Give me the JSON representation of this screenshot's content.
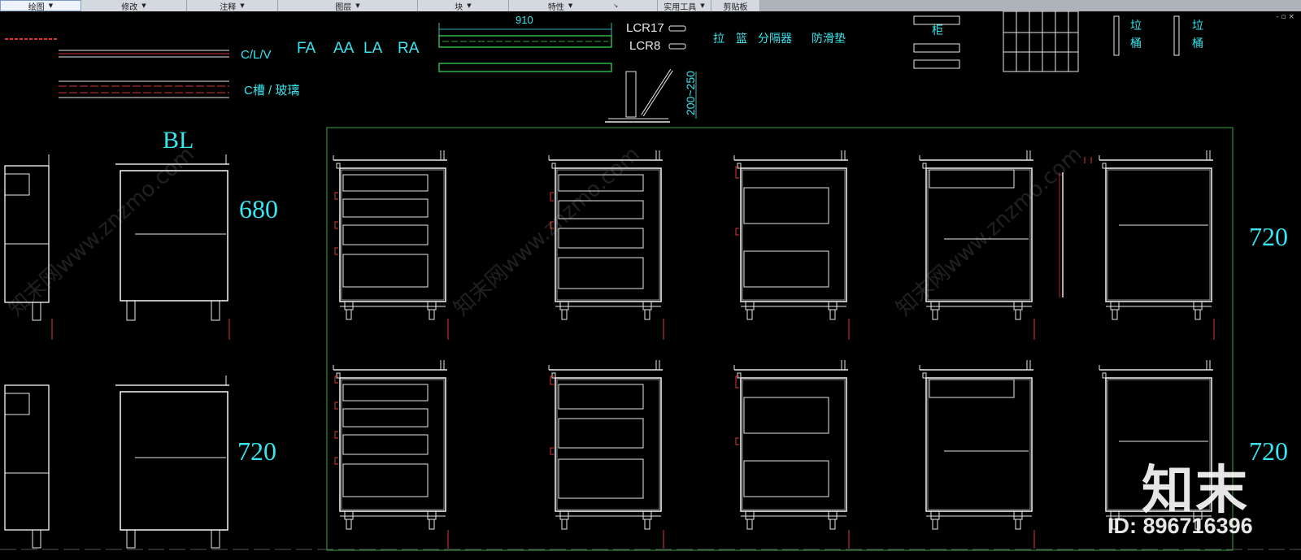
{
  "ribbon": {
    "panels": [
      {
        "label": "绘图"
      },
      {
        "label": "修改"
      },
      {
        "label": "注释"
      },
      {
        "label": "图层"
      },
      {
        "label": "块"
      },
      {
        "label": "特性"
      },
      {
        "label": "实用工具"
      },
      {
        "label": "剪贴板"
      }
    ]
  },
  "window_controls": "- ▫ ×",
  "drawing": {
    "labels": {
      "clv": "C/L/V",
      "c_groove": "C槽 / 玻璃",
      "fa": "FA",
      "aa": "AA",
      "la": "LA",
      "ra": "RA",
      "dim_910": "910",
      "lcr17": "LCR17",
      "lcr8": "LCR8",
      "lalan": "拉　篮",
      "divider": "分隔器",
      "antislip": "防滑垫",
      "gui": "柜",
      "laji1": "垃\n桶",
      "laji2": "垃\n桶",
      "dim_200_250": "200~250",
      "bl": "BL",
      "h680": "680",
      "h720a": "720",
      "h720b": "720",
      "h720c": "720"
    }
  },
  "watermark": {
    "brand": "知末",
    "id_text": "ID: 896716396",
    "diag_text": "知末网www.znzmo.com"
  },
  "colors": {
    "cyan": "#39e6ef",
    "cabinet": "#e8e8e8",
    "red": "#d83a32",
    "green": "#2ea84a",
    "frame": "#2f8a3a"
  }
}
